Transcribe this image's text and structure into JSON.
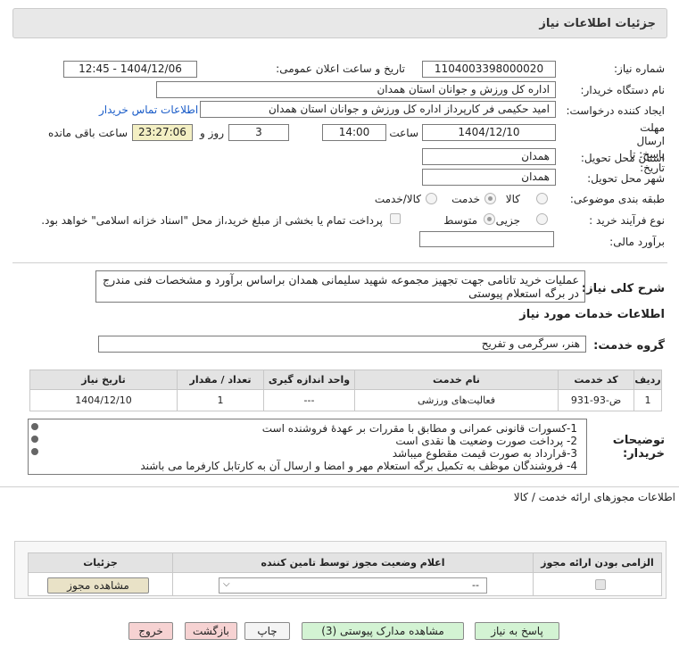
{
  "header": {
    "title": "جزئیات اطلاعات نیاز"
  },
  "form": {
    "need_number_label": "شماره نیاز:",
    "need_number": "1104003398000020",
    "announce_label": "تاریخ و ساعت اعلان عمومی:",
    "announce_value": "1404/12/06 - 12:45",
    "buyer_org_label": "نام دستگاه خریدار:",
    "buyer_org": "اداره کل ورزش و جوانان استان همدان",
    "requester_label": "ایجاد کننده درخواست:",
    "requester": "امید حکیمی فر کارپرداز اداره کل ورزش و جوانان استان همدان",
    "contact_link": "اطلاعات تماس خریدار",
    "deadline_label": "مهلت ارسال پاسخ: تا تاریخ:",
    "deadline_date": "1404/12/10",
    "time_label": "ساعت",
    "deadline_time": "14:00",
    "days_value": "3",
    "days_label": "روز و",
    "remaining_time": "23:27:06",
    "remaining_label": "ساعت باقی مانده",
    "province_label": "استان محل تحویل:",
    "province": "همدان",
    "city_label": "شهر محل تحویل:",
    "city": "همدان",
    "category_label": "طبقه بندی موضوعی:",
    "category_options": [
      "کالا",
      "خدمت",
      "کالا/خدمت"
    ],
    "category_selected": "خدمت",
    "process_label": "نوع فرآیند خرید :",
    "process_options": [
      "جزیی",
      "متوسط"
    ],
    "process_selected": "متوسط",
    "payment_note": "پرداخت تمام یا بخشی از مبلغ خرید،از محل \"اسناد خزانه اسلامی\" خواهد بود.",
    "estimate_label": "برآورد مالی:",
    "estimate_value": ""
  },
  "description": {
    "label": "شرح کلی نیاز:",
    "text": "عملیات خرید تاتامی جهت تجهیز مجموعه شهید سلیمانی همدان براساس برآورد و مشخصات فنی مندرج در برگه استعلام پیوستی"
  },
  "services": {
    "section_title": "اطلاعات خدمات مورد نیاز",
    "group_label": "گروه خدمت:",
    "group_value": "هنر، سرگرمی و تفریح",
    "columns": [
      "ردیف",
      "کد خدمت",
      "نام خدمت",
      "واحد اندازه گیری",
      "تعداد / مقدار",
      "تاریخ نیاز"
    ],
    "rows": [
      [
        "1",
        "ض-93-931",
        "فعالیت‌های ورزشی",
        "---",
        "1",
        "1404/12/10"
      ]
    ]
  },
  "notes": {
    "label": "توضیحات خریدار:",
    "lines": [
      "1-کسورات قانونی عمرانی و مطابق با مقررات بر عهدۀ فروشنده است",
      "2- پرداخت صورت وضعیت ها نقدی است",
      "3-قرارداد به صورت قیمت مقطوع میباشد",
      "4- فروشندگان موظف به تکمیل برگه استعلام مهر و امضا و ارسال آن به کارتابل کارفرما می باشند"
    ]
  },
  "permits": {
    "title": "اطلاعات مجوزهای ارائه خدمت / کالا",
    "columns": [
      "الزامی بودن ارائه مجوز",
      "اعلام وضعیت مجوز توسط تامین کننده",
      "جزئیات"
    ],
    "select_value": "--",
    "view_button": "مشاهده مجوز"
  },
  "actions": {
    "reply": "پاسخ به نیاز",
    "attachments": "مشاهده مدارک پیوستی (3)",
    "print": "چاپ",
    "back": "بازگشت",
    "exit": "خروج"
  }
}
